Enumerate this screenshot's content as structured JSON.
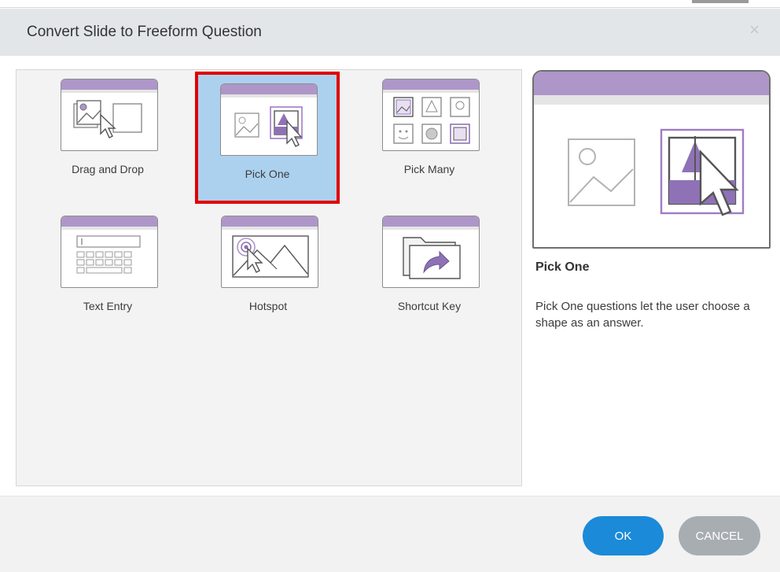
{
  "dialog": {
    "title": "Convert Slide to Freeform Question",
    "close_icon": "×"
  },
  "question_types": [
    {
      "label": "Drag and Drop",
      "icon": "drag-and-drop-icon",
      "selected": false
    },
    {
      "label": "Pick One",
      "icon": "pick-one-icon",
      "selected": true
    },
    {
      "label": "Pick Many",
      "icon": "pick-many-icon",
      "selected": false
    },
    {
      "label": "Text Entry",
      "icon": "text-entry-icon",
      "selected": false
    },
    {
      "label": "Hotspot",
      "icon": "hotspot-icon",
      "selected": false
    },
    {
      "label": "Shortcut Key",
      "icon": "shortcut-key-icon",
      "selected": false
    }
  ],
  "details": {
    "title": "Pick One",
    "description": "Pick One questions let the user choose a shape as an answer."
  },
  "buttons": {
    "ok": "OK",
    "cancel": "CANCEL"
  },
  "colors": {
    "accent_purple": "#ae96c9",
    "selection_blue": "#acd1ef",
    "selection_outline": "#e10000",
    "ok_button": "#1b8ad8",
    "cancel_button": "#a8adb2"
  }
}
